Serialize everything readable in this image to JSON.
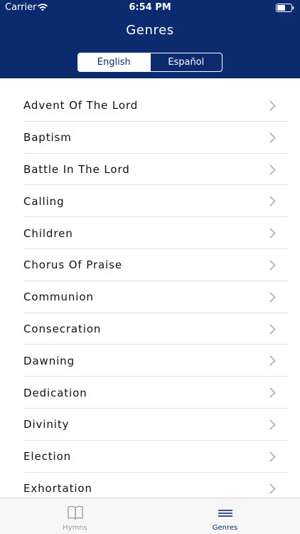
{
  "status_bar": {
    "carrier": "Carrier",
    "time": "6:54 PM"
  },
  "header": {
    "title": "Genres",
    "segments": [
      {
        "label": "English",
        "selected": true
      },
      {
        "label": "Español",
        "selected": false
      }
    ]
  },
  "genres": [
    {
      "label": "Advent Of The Lord"
    },
    {
      "label": "Baptism"
    },
    {
      "label": "Battle In The Lord"
    },
    {
      "label": "Calling"
    },
    {
      "label": "Children"
    },
    {
      "label": "Chorus Of Praise"
    },
    {
      "label": "Communion"
    },
    {
      "label": "Consecration"
    },
    {
      "label": "Dawning"
    },
    {
      "label": "Dedication"
    },
    {
      "label": "Divinity"
    },
    {
      "label": "Election"
    },
    {
      "label": "Exhortation"
    }
  ],
  "tabbar": {
    "tabs": [
      {
        "label": "Hymns",
        "icon": "book-icon",
        "active": false
      },
      {
        "label": "Genres",
        "icon": "list-icon",
        "active": true
      }
    ]
  },
  "colors": {
    "header_bg": "#0b2b6e",
    "accent": "#0b2b6e"
  }
}
